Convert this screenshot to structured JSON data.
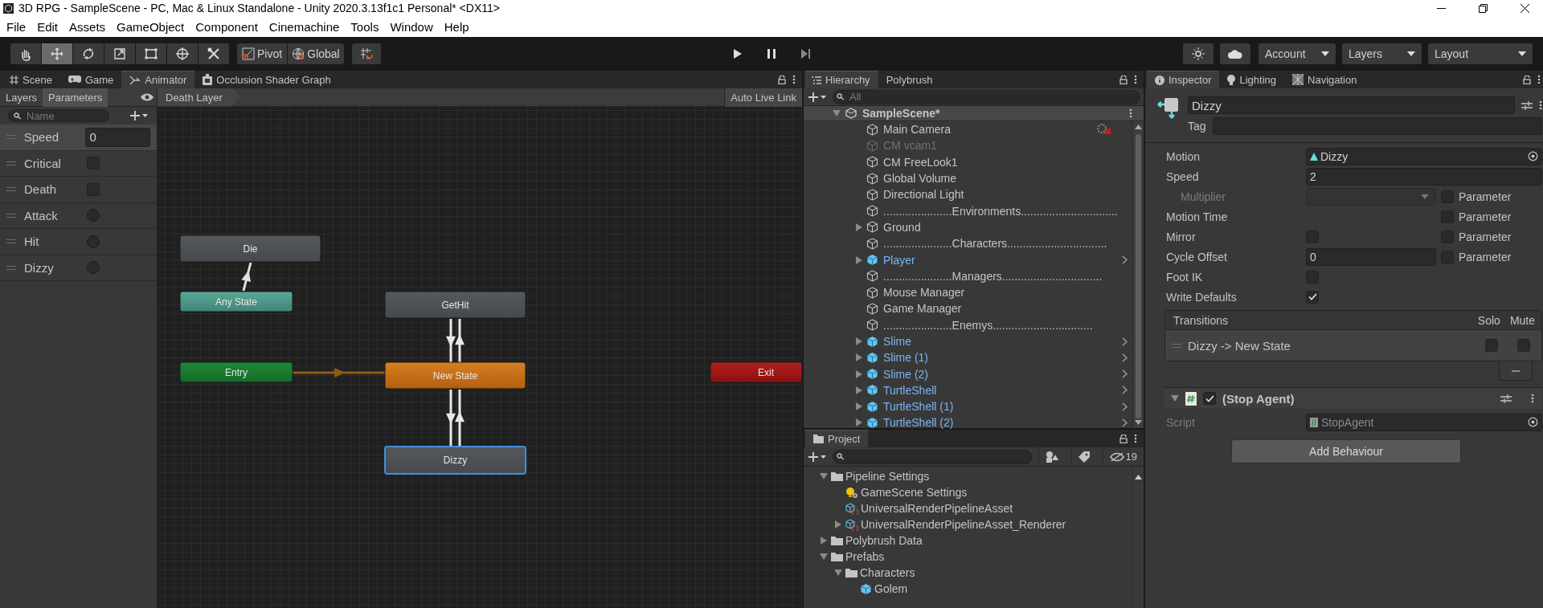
{
  "window": {
    "title": "3D RPG - SampleScene - PC, Mac & Linux Standalone - Unity 2020.3.13f1c1 Personal* <DX11>"
  },
  "menu": [
    "File",
    "Edit",
    "Assets",
    "GameObject",
    "Component",
    "Cinemachine",
    "Tools",
    "Window",
    "Help"
  ],
  "toolbar": {
    "tools": [
      {
        "selected": false
      },
      {
        "selected": true
      },
      {
        "selected": false
      },
      {
        "selected": false
      },
      {
        "selected": false
      },
      {
        "selected": false
      },
      {
        "selected": false
      }
    ],
    "pivot": "Pivot",
    "space": "Global",
    "dropdowns": [
      "Account",
      "Layers",
      "Layout"
    ]
  },
  "animator": {
    "tabs": [
      {
        "label": "Scene",
        "selected": false
      },
      {
        "label": "Game",
        "selected": false
      },
      {
        "label": "Animator",
        "selected": true
      },
      {
        "label": "Occlusion Shader Graph",
        "selected": false
      }
    ],
    "subtabs": [
      {
        "label": "Layers",
        "selected": false
      },
      {
        "label": "Parameters",
        "selected": true
      }
    ],
    "breadcrumb": "Death Layer",
    "live_link": "Auto Live Link",
    "search": {
      "placeholder": "Name"
    },
    "parameters": [
      {
        "name": "Speed",
        "kind": "float",
        "value": "0"
      },
      {
        "name": "Critical",
        "kind": "bool",
        "checked": false
      },
      {
        "name": "Death",
        "kind": "bool",
        "checked": false
      },
      {
        "name": "Attack",
        "kind": "trigger",
        "checked": false
      },
      {
        "name": "Hit",
        "kind": "trigger",
        "checked": false
      },
      {
        "name": "Dizzy",
        "kind": "trigger",
        "checked": false
      }
    ],
    "states": [
      {
        "label": "Die",
        "kind": "state",
        "selected": false
      },
      {
        "label": "Any State",
        "kind": "any",
        "selected": false
      },
      {
        "label": "Entry",
        "kind": "entry",
        "selected": false
      },
      {
        "label": "GetHit",
        "kind": "state",
        "selected": false
      },
      {
        "label": "New State",
        "kind": "default",
        "selected": false
      },
      {
        "label": "Dizzy",
        "kind": "state",
        "selected": true
      },
      {
        "label": "Exit",
        "kind": "exit",
        "selected": false
      }
    ]
  },
  "hierarchy": {
    "tabs": [
      {
        "label": "Hierarchy",
        "selected": true
      },
      {
        "label": "Polybrush",
        "selected": false
      }
    ],
    "search": {
      "placeholder": "All"
    },
    "scene": "SampleScene*",
    "items": [
      {
        "label": "Main Camera",
        "kind": "object",
        "disabled": false
      },
      {
        "label": "CM vcam1",
        "kind": "object",
        "disabled": true
      },
      {
        "label": "CM FreeLook1",
        "kind": "object",
        "disabled": false
      },
      {
        "label": "Global Volume",
        "kind": "object",
        "disabled": false
      },
      {
        "label": "Directional Light",
        "kind": "object",
        "disabled": false
      },
      {
        "label": "......................Environments...............................",
        "kind": "object",
        "disabled": false
      },
      {
        "label": "Ground",
        "kind": "object",
        "disabled": false,
        "expanded": false
      },
      {
        "label": "......................Characters................................",
        "kind": "object",
        "disabled": false
      },
      {
        "label": "Player",
        "kind": "prefab",
        "disabled": false,
        "expanded": false
      },
      {
        "label": "......................Managers................................",
        "kind": "object",
        "disabled": false
      },
      {
        "label": "Mouse Manager",
        "kind": "object",
        "disabled": false
      },
      {
        "label": "Game Manager",
        "kind": "object",
        "disabled": false
      },
      {
        "label": "......................Enemys................................",
        "kind": "object",
        "disabled": false
      },
      {
        "label": "Slime",
        "kind": "prefab",
        "disabled": false,
        "expanded": false
      },
      {
        "label": "Slime (1)",
        "kind": "prefab",
        "disabled": false,
        "expanded": false
      },
      {
        "label": "Slime (2)",
        "kind": "prefab",
        "disabled": false,
        "expanded": false
      },
      {
        "label": "TurtleShell",
        "kind": "prefab",
        "disabled": false,
        "expanded": false
      },
      {
        "label": "TurtleShell (1)",
        "kind": "prefab",
        "disabled": false,
        "expanded": false
      },
      {
        "label": "TurtleShell (2)",
        "kind": "prefab",
        "disabled": false,
        "expanded": false
      }
    ]
  },
  "project": {
    "tabs": [
      {
        "label": "Project",
        "selected": true
      }
    ],
    "hidden_count": "19",
    "tree": [
      {
        "label": "Pipeline Settings",
        "kind": "folder",
        "expanded": true,
        "children": [
          {
            "label": "GameScene Settings",
            "kind": "settings"
          },
          {
            "label": "UniversalRenderPipelineAsset",
            "kind": "asset"
          },
          {
            "label": "UniversalRenderPipelineAsset_Renderer",
            "kind": "asset",
            "expanded": false
          }
        ]
      },
      {
        "label": "Polybrush Data",
        "kind": "folder",
        "expanded": false
      },
      {
        "label": "Prefabs",
        "kind": "folder",
        "expanded": true,
        "children": [
          {
            "label": "Characters",
            "kind": "folder",
            "expanded": true,
            "children": [
              {
                "label": "Golem",
                "kind": "prefab"
              }
            ]
          }
        ]
      }
    ]
  },
  "inspector": {
    "tabs": [
      {
        "label": "Inspector",
        "selected": true
      },
      {
        "label": "Lighting",
        "selected": false
      },
      {
        "label": "Navigation",
        "selected": false
      }
    ],
    "name": "Dizzy",
    "tag_label": "Tag",
    "fields": [
      {
        "label": "Motion",
        "kind": "object",
        "value": "Dizzy",
        "disabled": false
      },
      {
        "label": "Speed",
        "kind": "number",
        "value": "2",
        "disabled": false
      },
      {
        "label": "Multiplier",
        "kind": "dropdown",
        "disabled": true,
        "parameter": "Parameter",
        "param_checked": false
      },
      {
        "label": "Motion Time",
        "kind": "blank",
        "disabled": false,
        "parameter": "Parameter",
        "param_checked": false
      },
      {
        "label": "Mirror",
        "kind": "toggle",
        "checked": false,
        "disabled": false,
        "parameter": "Parameter",
        "param_checked": false
      },
      {
        "label": "Cycle Offset",
        "kind": "number",
        "value": "0",
        "disabled": false,
        "parameter": "Parameter",
        "param_checked": false
      },
      {
        "label": "Foot IK",
        "kind": "toggle",
        "checked": false,
        "disabled": false
      },
      {
        "label": "Write Defaults",
        "kind": "toggle",
        "checked": true,
        "disabled": false
      }
    ],
    "transitions": {
      "title": "Transitions",
      "columns": [
        "Solo",
        "Mute"
      ],
      "items": [
        {
          "label": "Dizzy -> New State",
          "solo": false,
          "mute": false
        }
      ]
    },
    "behaviour": {
      "title": "(Stop Agent)",
      "enabled": true,
      "script_label": "Script",
      "script": "StopAgent"
    },
    "add_button": "Add Behaviour"
  }
}
